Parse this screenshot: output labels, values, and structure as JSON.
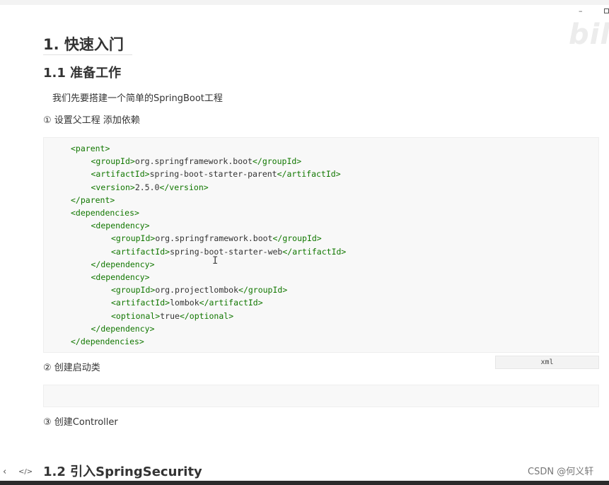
{
  "window": {
    "minimize_icon": "minimize-icon",
    "maximize_icon": "maximize-icon"
  },
  "watermark": "bili",
  "headings": {
    "h1": "1. 快速入门",
    "h2_prepare": "1.1 准备工作",
    "h2_security": "1.2 引入SpringSecurity"
  },
  "intro": "我们先要搭建一个简单的SpringBoot工程",
  "steps": {
    "step1": "① 设置父工程 添加依赖",
    "step2": "② 创建启动类",
    "step3": "③ 创建Controller"
  },
  "code": {
    "language": "xml",
    "lines": [
      {
        "indent": 0,
        "parts": [
          {
            "t": "tag",
            "v": "<parent>"
          }
        ]
      },
      {
        "indent": 1,
        "parts": [
          {
            "t": "tag",
            "v": "<groupId>"
          },
          {
            "t": "txt",
            "v": "org.springframework.boot"
          },
          {
            "t": "tag",
            "v": "</groupId>"
          }
        ]
      },
      {
        "indent": 1,
        "parts": [
          {
            "t": "tag",
            "v": "<artifactId>"
          },
          {
            "t": "txt",
            "v": "spring-boot-starter-parent"
          },
          {
            "t": "tag",
            "v": "</artifactId>"
          }
        ]
      },
      {
        "indent": 1,
        "parts": [
          {
            "t": "tag",
            "v": "<version>"
          },
          {
            "t": "txt",
            "v": "2.5.0"
          },
          {
            "t": "tag",
            "v": "</version>"
          }
        ]
      },
      {
        "indent": 0,
        "parts": [
          {
            "t": "tag",
            "v": "</parent>"
          }
        ]
      },
      {
        "indent": 0,
        "parts": [
          {
            "t": "tag",
            "v": "<dependencies>"
          }
        ]
      },
      {
        "indent": 1,
        "parts": [
          {
            "t": "tag",
            "v": "<dependency>"
          }
        ]
      },
      {
        "indent": 2,
        "parts": [
          {
            "t": "tag",
            "v": "<groupId>"
          },
          {
            "t": "txt",
            "v": "org.springframework.boot"
          },
          {
            "t": "tag",
            "v": "</groupId>"
          }
        ]
      },
      {
        "indent": 2,
        "parts": [
          {
            "t": "tag",
            "v": "<artifactId>"
          },
          {
            "t": "txt",
            "v": "spring-boot-starter-web"
          },
          {
            "t": "tag",
            "v": "</artifactId>"
          }
        ]
      },
      {
        "indent": 1,
        "parts": [
          {
            "t": "tag",
            "v": "</dependency>"
          }
        ]
      },
      {
        "indent": 1,
        "parts": [
          {
            "t": "tag",
            "v": "<dependency>"
          }
        ]
      },
      {
        "indent": 2,
        "parts": [
          {
            "t": "tag",
            "v": "<groupId>"
          },
          {
            "t": "txt",
            "v": "org.projectlombok"
          },
          {
            "t": "tag",
            "v": "</groupId>"
          }
        ]
      },
      {
        "indent": 2,
        "parts": [
          {
            "t": "tag",
            "v": "<artifactId>"
          },
          {
            "t": "txt",
            "v": "lombok"
          },
          {
            "t": "tag",
            "v": "</artifactId>"
          }
        ]
      },
      {
        "indent": 2,
        "parts": [
          {
            "t": "tag",
            "v": "<optional>"
          },
          {
            "t": "txt",
            "v": "true"
          },
          {
            "t": "tag",
            "v": "</optional>"
          }
        ]
      },
      {
        "indent": 1,
        "parts": [
          {
            "t": "tag",
            "v": "</dependency>"
          }
        ]
      },
      {
        "indent": 0,
        "parts": [
          {
            "t": "tag",
            "v": "</dependencies>"
          }
        ]
      }
    ]
  },
  "nav": {
    "prev": "‹",
    "code": "</>"
  },
  "credit": "CSDN @何义轩",
  "colors": {
    "tag": "#117700",
    "code_bg": "#f8f8f8"
  }
}
